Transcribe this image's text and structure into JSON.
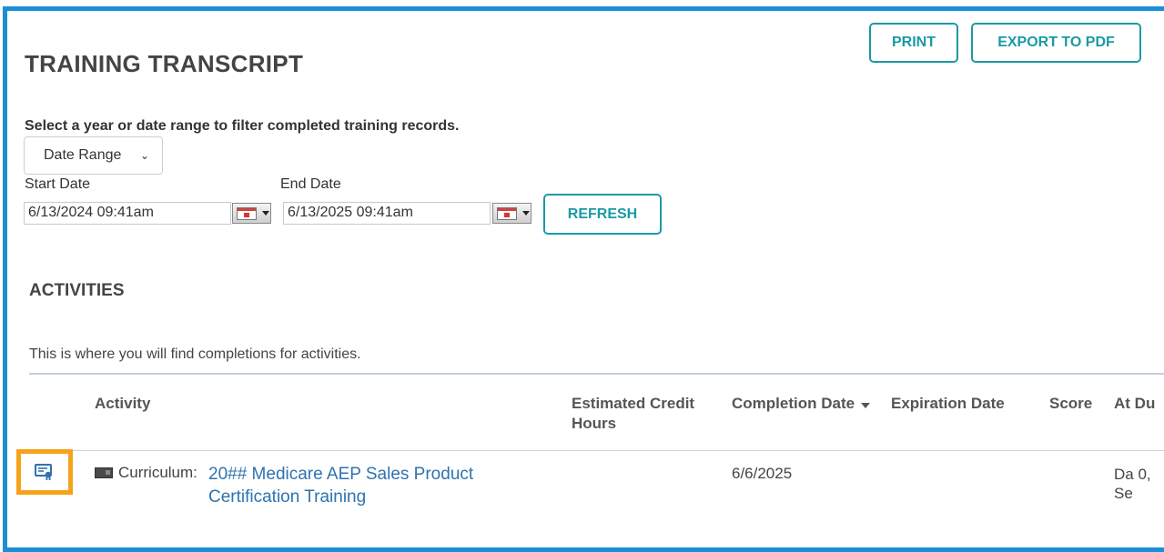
{
  "header": {
    "title": "TRAINING TRANSCRIPT",
    "print_label": "PRINT",
    "export_label": "EXPORT TO PDF"
  },
  "filter": {
    "instruction": "Select a year or date range to filter completed training records.",
    "mode_selected": "Date Range",
    "start_label": "Start Date",
    "start_value": "6/13/2024 09:41am",
    "end_label": "End Date",
    "end_value": "6/13/2025 09:41am",
    "refresh_label": "REFRESH"
  },
  "activities": {
    "title": "ACTIVITIES",
    "description": "This is where you will find completions for activities.",
    "columns": {
      "activity": "Activity",
      "credit_hours": "Estimated Credit Hours",
      "completion_date": "Completion Date",
      "expiration_date": "Expiration Date",
      "score": "Score",
      "attempt_duration": "At Du"
    },
    "rows": [
      {
        "type_label": "Curriculum:",
        "title": "20## Medicare AEP Sales Product Certification Training",
        "completion_date": "6/6/2025",
        "attempt_duration": "Da 0, Se"
      }
    ]
  },
  "colors": {
    "frame": "#1a8fd6",
    "accent": "#1a9aa6",
    "highlight": "#f7a21b",
    "link": "#2e73b0"
  },
  "icons": {
    "certificate": "certificate-icon",
    "curriculum": "curriculum-icon",
    "calendar": "calendar-icon",
    "sort": "sort-down-icon",
    "dropdown": "chevron-down-icon"
  }
}
